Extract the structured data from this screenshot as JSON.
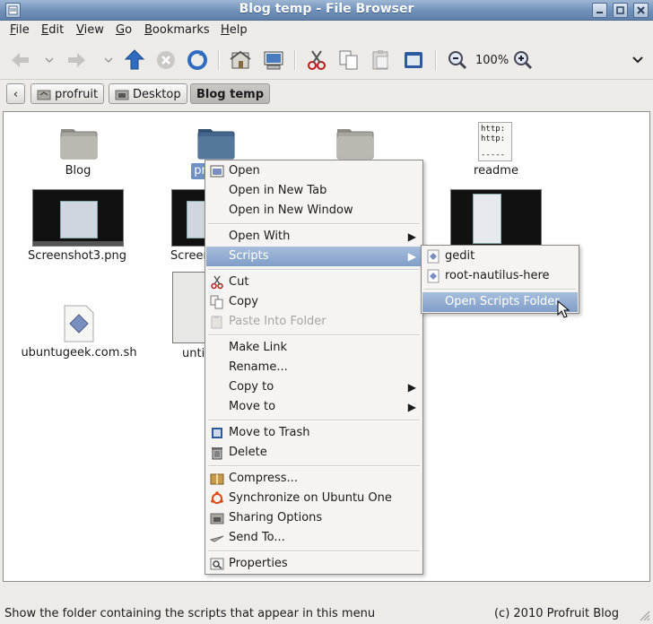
{
  "window": {
    "title": "Blog temp - File Browser"
  },
  "menubar": [
    "File",
    "Edit",
    "View",
    "Go",
    "Bookmarks",
    "Help"
  ],
  "toolbar": {
    "zoom": "100%"
  },
  "pathbar": {
    "crumbs": [
      "profruit",
      "Desktop",
      "Blog temp"
    ]
  },
  "files": {
    "blog": "Blog",
    "selected_partial": "pr",
    "readme": "readme",
    "readme_icon_text": [
      "http:",
      "http:",
      "-----"
    ],
    "shot3": "Screenshot3.png",
    "shot_partial": "Screen",
    "sh": "ubuntugeek.com.sh",
    "untitled_partial": "unti"
  },
  "context_menu": {
    "open": "Open",
    "open_tab": "Open in New Tab",
    "open_window": "Open in New Window",
    "open_with": "Open With",
    "scripts": "Scripts",
    "cut": "Cut",
    "copy": "Copy",
    "paste_into": "Paste Into Folder",
    "make_link": "Make Link",
    "rename": "Rename...",
    "copy_to": "Copy to",
    "move_to": "Move to",
    "trash": "Move to Trash",
    "delete": "Delete",
    "compress": "Compress...",
    "sync": "Synchronize on Ubuntu One",
    "sharing": "Sharing Options",
    "send_to": "Send To...",
    "properties": "Properties"
  },
  "submenu": {
    "gedit": "gedit",
    "root_nautilus": "root-nautilus-here",
    "open_scripts": "Open Scripts Folder"
  },
  "status": {
    "message": "Show the folder containing the scripts that appear in this menu",
    "copyright": "(c) 2010 Profruit Blog"
  },
  "colors": {
    "highlight": "#7f9ec8",
    "titlebar": "#6f90b8",
    "folder": "#a7a69f",
    "selected_folder": "#44658c"
  }
}
